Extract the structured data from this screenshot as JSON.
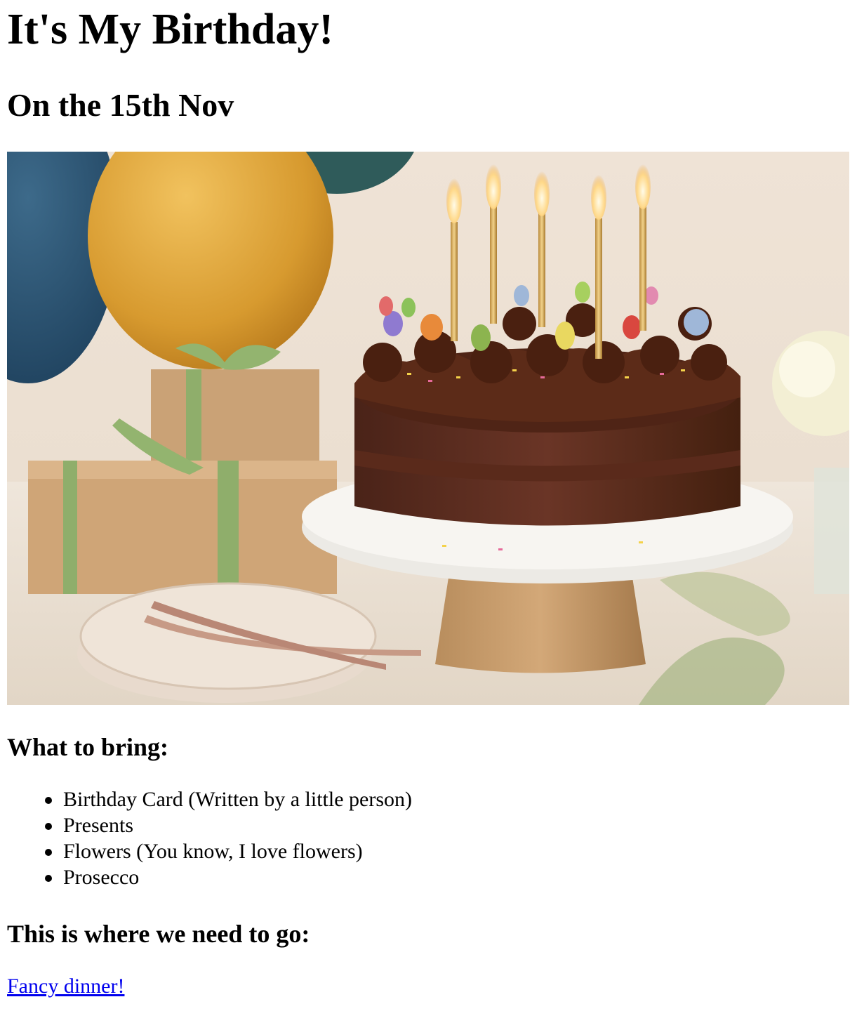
{
  "title": "It's My Birthday!",
  "subtitle": "On the 15th Nov",
  "image": {
    "subject": "chocolate birthday cake with lit candles on a cake stand, gifts and balloons"
  },
  "bring": {
    "heading": "What to bring:",
    "items": [
      "Birthday Card (Written by a little person)",
      "Presents",
      "Flowers (You know, I love flowers)",
      "Prosecco"
    ]
  },
  "location": {
    "heading": "This is where we need to go:",
    "link_text": "Fancy dinner!"
  },
  "colors": {
    "link": "#0000ee",
    "text": "#000000",
    "background": "#ffffff"
  }
}
